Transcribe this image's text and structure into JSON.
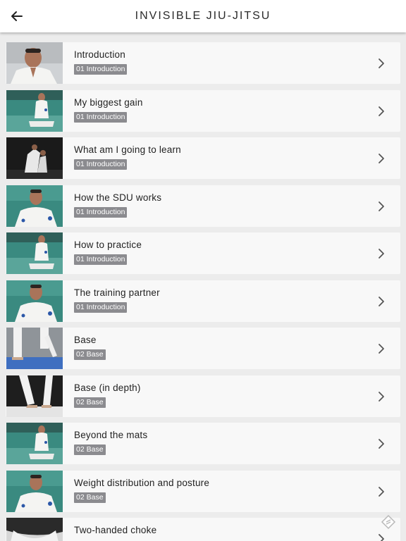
{
  "header": {
    "title": "INVISIBLE JIU-JITSU",
    "back_icon": "arrow-left-icon"
  },
  "lessons": [
    {
      "title": "Introduction",
      "category": "01 Introduction",
      "thumb": "speaker-close"
    },
    {
      "title": "My biggest gain",
      "category": "01 Introduction",
      "thumb": "seated-mat"
    },
    {
      "title": "What am I going to learn",
      "category": "01 Introduction",
      "thumb": "sparring-dark"
    },
    {
      "title": "How the SDU works",
      "category": "01 Introduction",
      "thumb": "speaker-mat"
    },
    {
      "title": "How to practice",
      "category": "01 Introduction",
      "thumb": "seated-mat"
    },
    {
      "title": "The training partner",
      "category": "01 Introduction",
      "thumb": "speaker-mat"
    },
    {
      "title": "Base",
      "category": "02 Base",
      "thumb": "legs-blue"
    },
    {
      "title": "Base (in depth)",
      "category": "02 Base",
      "thumb": "legs-dark"
    },
    {
      "title": "Beyond the mats",
      "category": "02 Base",
      "thumb": "seated-mat"
    },
    {
      "title": "Weight distribution and posture",
      "category": "02 Base",
      "thumb": "speaker-mat"
    },
    {
      "title": "Two-handed choke",
      "category": "",
      "thumb": "choke-closeup"
    }
  ],
  "colors": {
    "tag_bg": "#8b8b8f",
    "mat_green": "#2f7f76",
    "background": "#ececec"
  },
  "icons": {
    "row_chevron": "chevron-right-icon",
    "floating": "tag-diamond-icon"
  }
}
